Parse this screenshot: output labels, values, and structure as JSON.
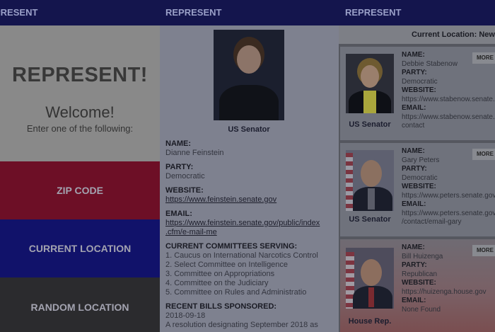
{
  "panel1": {
    "app_bar": "PRESENT",
    "title": "REPRESENT!",
    "welcome": "Welcome!",
    "prompt": "Enter one of the following:",
    "buttons": [
      "ZIP CODE",
      "CURRENT LOCATION",
      "RANDOM LOCATION"
    ]
  },
  "panel2": {
    "app_bar": "REPRESENT",
    "caption": "US Senator",
    "name_label": "NAME:",
    "name": "Dianne Feinstein",
    "party_label": "PARTY:",
    "party": "Democratic",
    "website_label": "WEBSITE:",
    "website": "https://www.feinstein.senate.gov",
    "email_label": "EMAIL:",
    "email_1": "https://www.feinstein.senate.gov/public/index",
    "email_2": ".cfm/e-mail-me",
    "committees_label": "CURRENT COMMITTEES SERVING:",
    "committees": [
      "1. Caucus on International Narcotics Control",
      "2. Select Committee on Intelligence",
      "3. Committee on Appropriations",
      "4. Committee on the Judiciary",
      "5. Committee on Rules and Administratio"
    ],
    "bills_label": "RECENT BILLS SPONSORED:",
    "bill_date": "2018-09-18",
    "bill_text": "A resolution designating September 2018 as"
  },
  "panel3": {
    "app_bar": "REPRESENT",
    "current_location": "Current Location: Neway",
    "more_label": "MORE",
    "labels": {
      "name": "NAME:",
      "party": "PARTY:",
      "website": "WEBSITE:",
      "email": "EMAIL:"
    },
    "cards": [
      {
        "caption": "US Senator",
        "name": "Debbie Stabenow",
        "party": "Democratic",
        "website": "https://www.stabenow.senate.g",
        "email_1": "https://www.stabenow.senate.g",
        "email_2": "contact"
      },
      {
        "caption": "US Senator",
        "name": "Gary Peters",
        "party": "Democratic",
        "website": "https://www.peters.senate.gov",
        "email_1": "https://www.peters.senate.gov",
        "email_2": "/contact/email-gary"
      },
      {
        "caption": "House Rep.",
        "name": "Bill Huizenga",
        "party": "Republican",
        "website": "https://huizenga.house.gov",
        "email_1": "None Found",
        "email_2": ""
      }
    ]
  }
}
